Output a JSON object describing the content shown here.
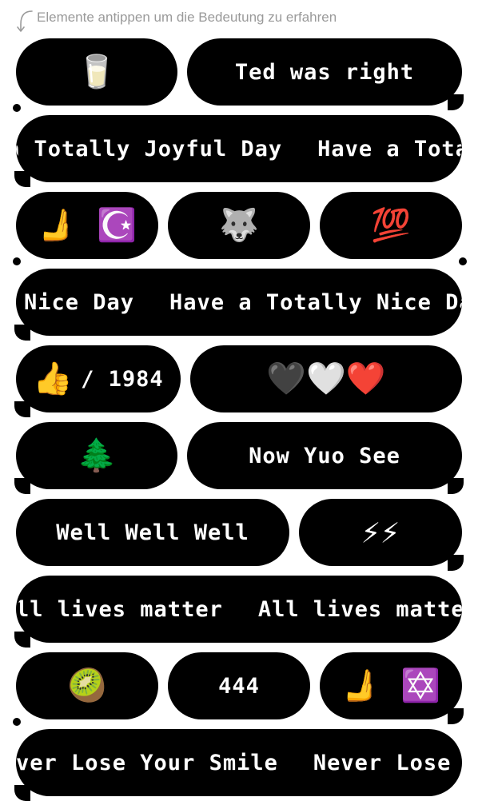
{
  "hint": {
    "text": "Elemente antippen um die Bedeutung zu erfahren",
    "icon": "curved-arrow-icon"
  },
  "bubbles": {
    "r1a": "🥛",
    "r1b": "Ted was right",
    "r2_ticker": [
      "a Totally Joyful Day",
      "Have a Totally"
    ],
    "r3a": "🫸 ☪️",
    "r3b": "🐺",
    "r3c": "💯",
    "r4_ticker": [
      "Nice Day",
      "Have a Totally Nice Day"
    ],
    "r5a_emoji": "👍",
    "r5a_sep": "/ 1984",
    "r5b": "🖤🤍❤️",
    "r6a": "🌲",
    "r6b": "Now Yuo See",
    "r7a": "Well Well Well",
    "r7b": "⚡⚡",
    "r8_ticker": [
      "ll lives matter",
      "All lives matter",
      "A"
    ],
    "r9a": "🥝",
    "r9b": "444",
    "r9c": "🫸 ✡️",
    "r10_ticker": [
      "ver Lose Your Smile",
      "Never Lose Y"
    ]
  },
  "colors": {
    "bubble_bg": "#000000",
    "bubble_text": "#ffffff",
    "hint_text": "#9a9a9a"
  }
}
